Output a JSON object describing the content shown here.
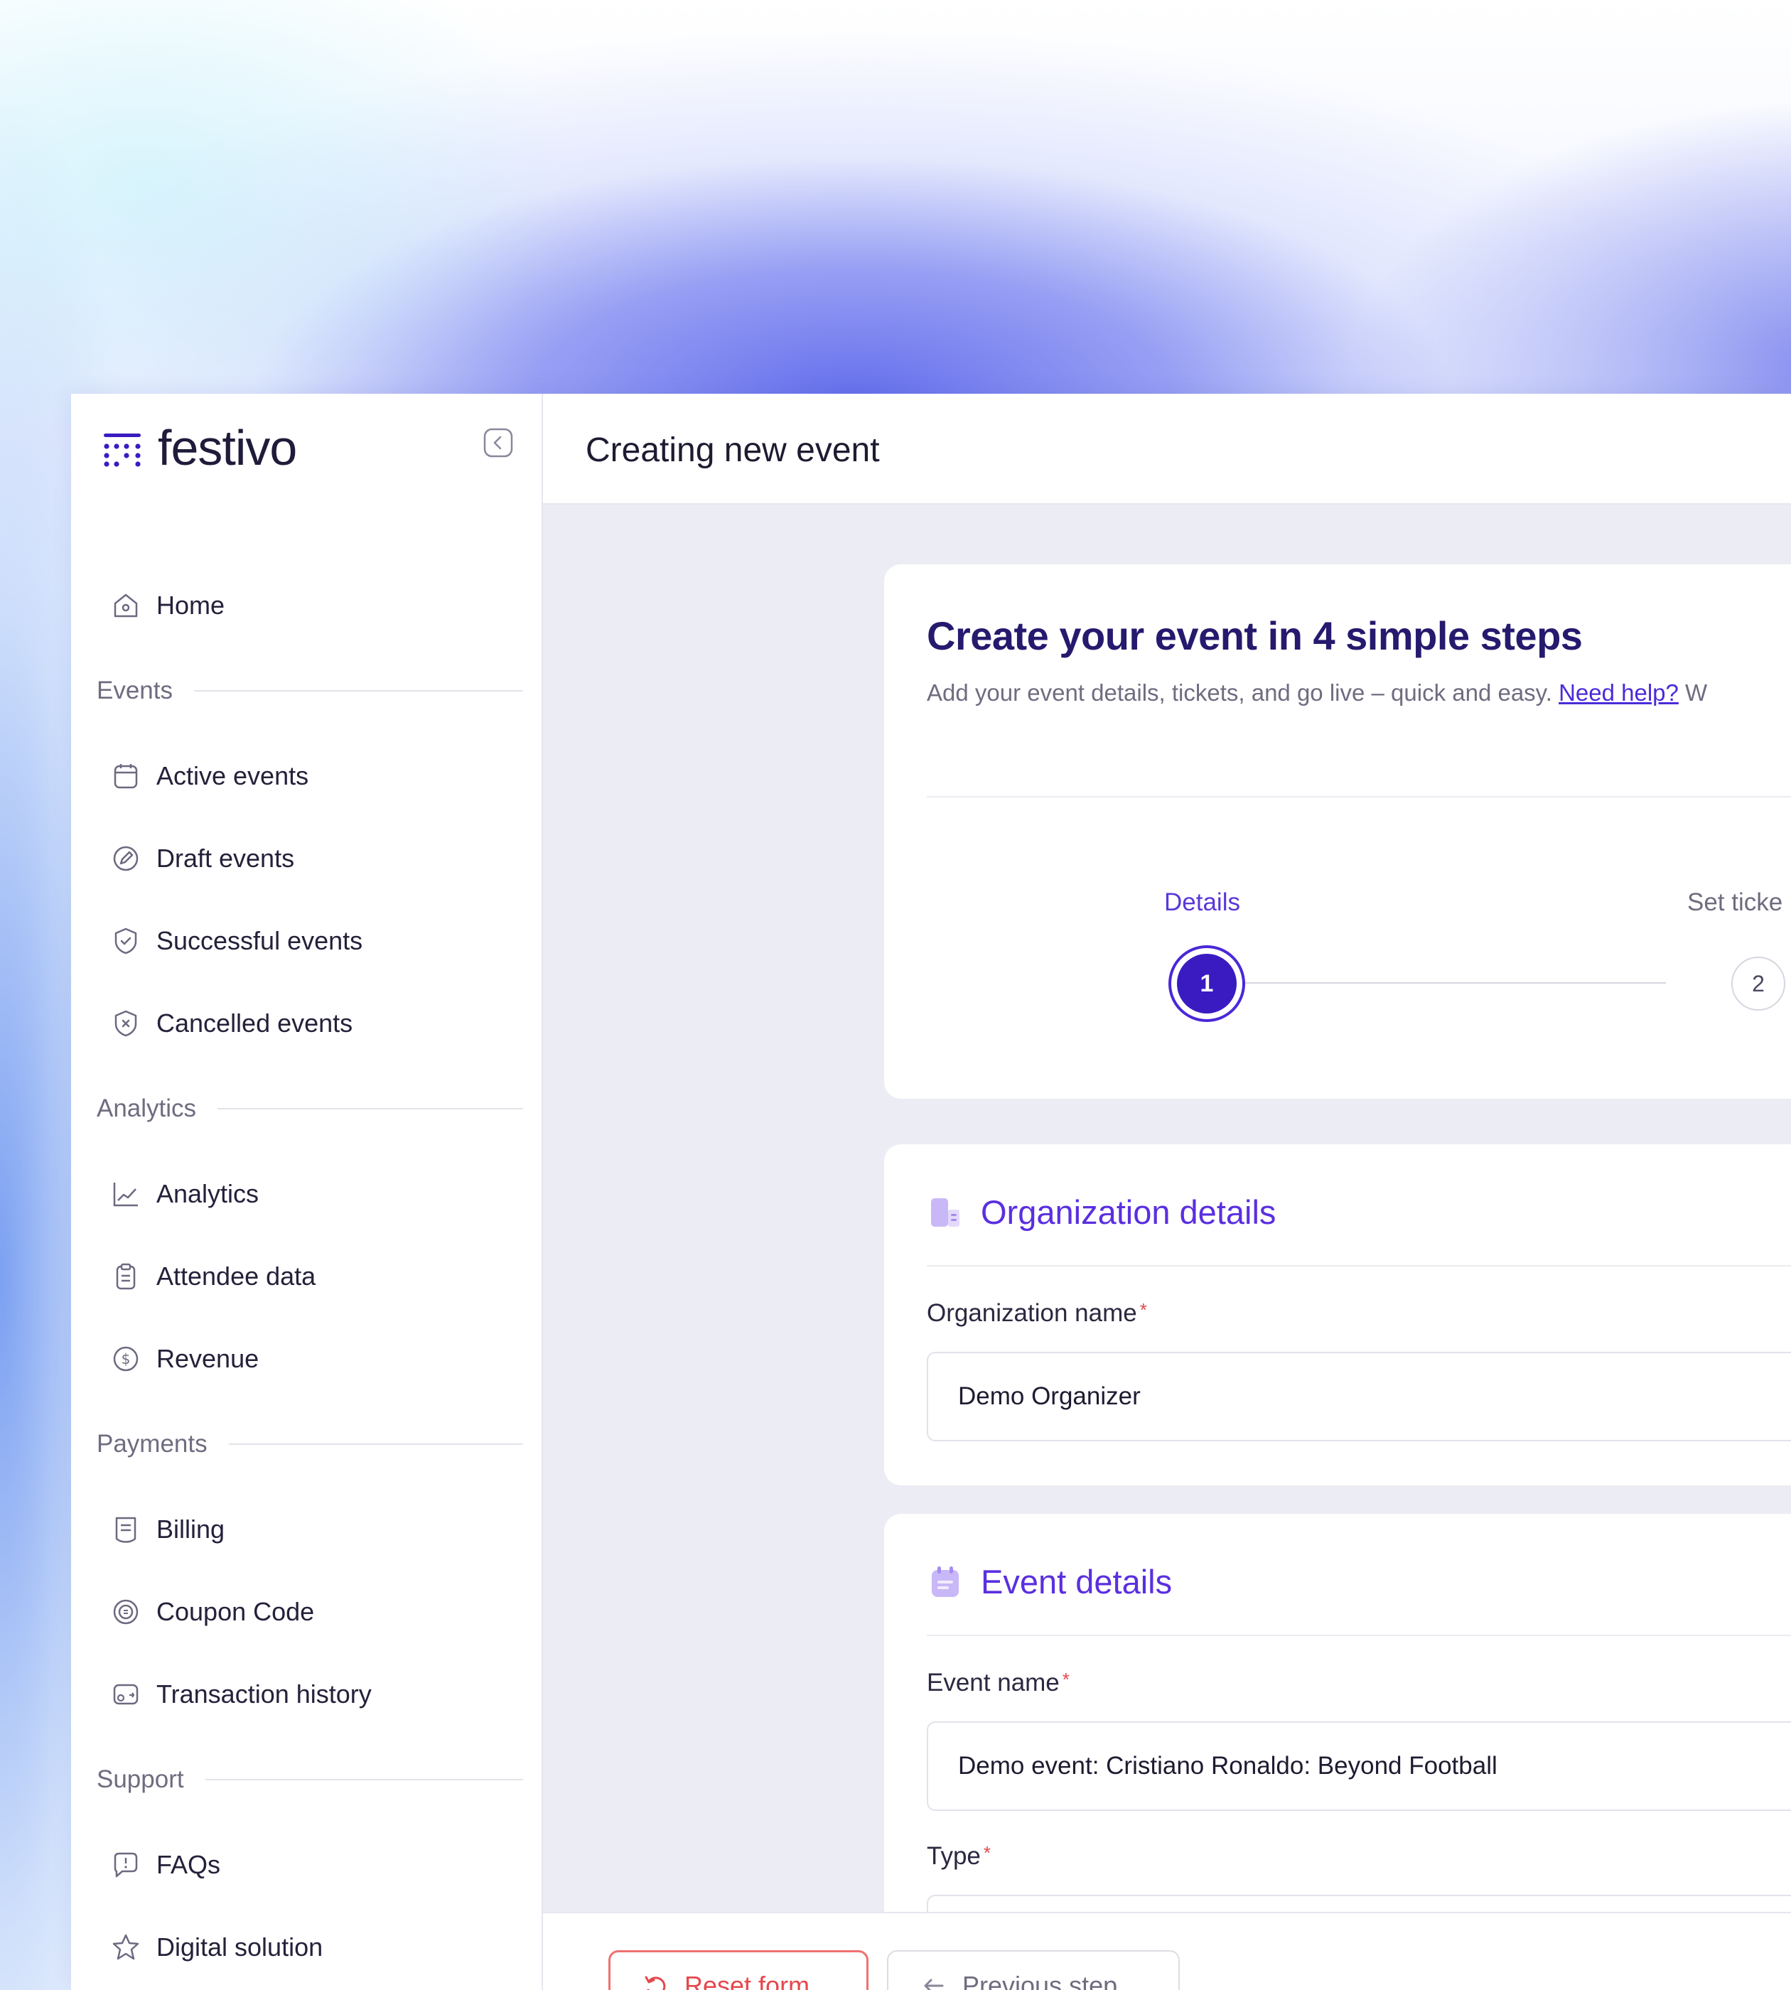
{
  "brand": {
    "name": "festivo"
  },
  "sidebar": {
    "home": {
      "label": "Home",
      "icon": "home-icon"
    },
    "sections": [
      {
        "title": "Events",
        "items": [
          {
            "label": "Active events",
            "icon": "calendar-icon"
          },
          {
            "label": "Draft events",
            "icon": "pencil-icon"
          },
          {
            "label": "Successful events",
            "icon": "check-badge-icon"
          },
          {
            "label": "Cancelled events",
            "icon": "cancel-badge-icon"
          }
        ]
      },
      {
        "title": "Analytics",
        "items": [
          {
            "label": "Analytics",
            "icon": "line-chart-icon"
          },
          {
            "label": "Attendee data",
            "icon": "clipboard-icon"
          },
          {
            "label": "Revenue",
            "icon": "dollar-icon"
          }
        ]
      },
      {
        "title": "Payments",
        "items": [
          {
            "label": "Billing",
            "icon": "receipt-icon"
          },
          {
            "label": "Coupon Code",
            "icon": "coupon-icon"
          },
          {
            "label": "Transaction history",
            "icon": "transaction-icon"
          }
        ]
      },
      {
        "title": "Support",
        "items": [
          {
            "label": "FAQs",
            "icon": "chat-question-icon"
          },
          {
            "label": "Digital solution",
            "icon": "star-icon"
          }
        ]
      }
    ]
  },
  "header": {
    "title": "Creating new event"
  },
  "wizard": {
    "title": "Create your event in 4 simple steps",
    "subtitle": "Add your event details, tickets, and go live – quick and easy.",
    "help_link": "Need help?",
    "subtitle_tail": " W",
    "steps": [
      {
        "number": "1",
        "label": "Details",
        "active": true
      },
      {
        "number": "2",
        "label": "Set ticke",
        "active": false
      }
    ]
  },
  "organization": {
    "title": "Organization details",
    "name_label": "Organization name",
    "name_value": "Demo Organizer"
  },
  "event": {
    "title": "Event details",
    "name_label": "Event name",
    "name_value": "Demo event: Cristiano Ronaldo: Beyond Football",
    "type_label": "Type"
  },
  "footer": {
    "reset_label": "Reset form",
    "prev_label": "Previous step"
  },
  "colors": {
    "accent": "#5a2fe0",
    "accent_dark": "#3a1bc2",
    "danger": "#e5484d",
    "main_bg": "#ececf4"
  }
}
